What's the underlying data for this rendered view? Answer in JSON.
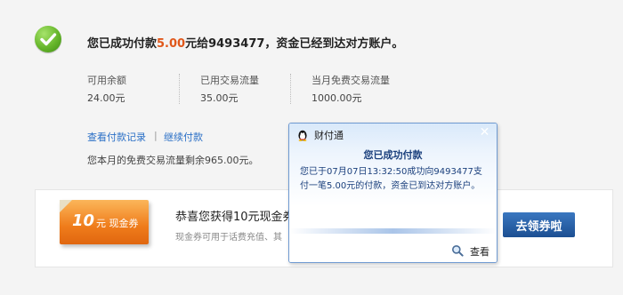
{
  "header": {
    "title_prefix": "您已成功付款",
    "amount": "5.00",
    "title_suffix": "元给9493477，资金已经到达对方账户。"
  },
  "stats": [
    {
      "label": "可用余额",
      "value": "24.00元"
    },
    {
      "label": "已用交易流量",
      "value": "35.00元"
    },
    {
      "label": "当月免费交易流量",
      "value": "1000.00元"
    }
  ],
  "links": {
    "view_record": "查看付款记录",
    "separator": "|",
    "continue_pay": "继续付款"
  },
  "note": "您本月的免费交易流量剩余965.00元。",
  "coupon": {
    "ticket_amount": "10",
    "ticket_unit": "元 现金券",
    "title": "恭喜您获得10元现金券",
    "subtitle": "现金券可用于话费充值、其",
    "claim_button": "去领券啦"
  },
  "popup": {
    "app_name": "财付通",
    "close_glyph": "✕",
    "heading": "您已成功付款",
    "message": "您已于07月07日13:32:50成功向9493477支付一笔5.00元的付款，资金已到达对方账户。",
    "view_link": "查看"
  },
  "colors": {
    "accent_orange": "#e0571a",
    "link_blue": "#2a6fc6",
    "button_blue": "#2a62a8",
    "success_green": "#66b62a"
  },
  "icons": [
    "success-check-icon",
    "qq-penguin-icon",
    "close-icon",
    "magnifier-icon"
  ]
}
